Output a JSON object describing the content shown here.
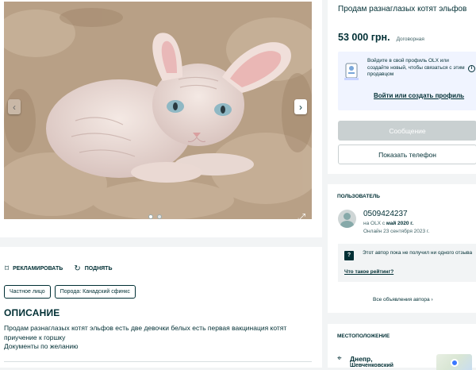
{
  "gallery": {
    "prev_icon": "chevron-left-icon",
    "next_icon": "chevron-right-icon",
    "expand_icon": "expand-icon",
    "dots_count": 2
  },
  "details": {
    "promote_label": "РЕКЛАМИРОВАТЬ",
    "raise_label": "ПОДНЯТЬ",
    "tags": [
      "Частное лицо",
      "Порода: Канадский сфинкс"
    ],
    "description_title": "ОПИСАНИЕ",
    "description_lines": [
      "Продам разнаглазых котят эльфов есть две девочки белых есть первая вакцинация котят",
      "приучение к горшку",
      "Документы по желанию"
    ]
  },
  "listing": {
    "title": "Продам разнаглазых котят эльфов",
    "price": "53 000 грн.",
    "negotiable": "Договорная",
    "login_prompt": "Войдите в свой профиль OLX или создайте новый, чтобы связаться с этим продавцом",
    "login_link": "Войти или создать профиль",
    "message_button": "Сообщение",
    "phone_button": "Показать телефон"
  },
  "user": {
    "section_label": "ПОЛЬЗОВАТЕЛЬ",
    "name": "0509424237",
    "since_prefix": "на OLX с",
    "since_date": "май 2020 г.",
    "online": "Онлайн 23 сентября 2023 г.",
    "rating_text": "Этот автор пока не получил ни одного отзыва",
    "rating_link": "Что такое рейтинг?",
    "all_ads": "Все объявления автора"
  },
  "location": {
    "section_label": "МЕСТОПОЛОЖЕНИЕ",
    "city": "Днепр,",
    "district": "Шевченковский"
  },
  "colors": {
    "primary": "#002f34",
    "login_bg": "#f0f4ff",
    "disabled_button": "#c9d0d1",
    "page_bg": "#f2f4f5"
  }
}
